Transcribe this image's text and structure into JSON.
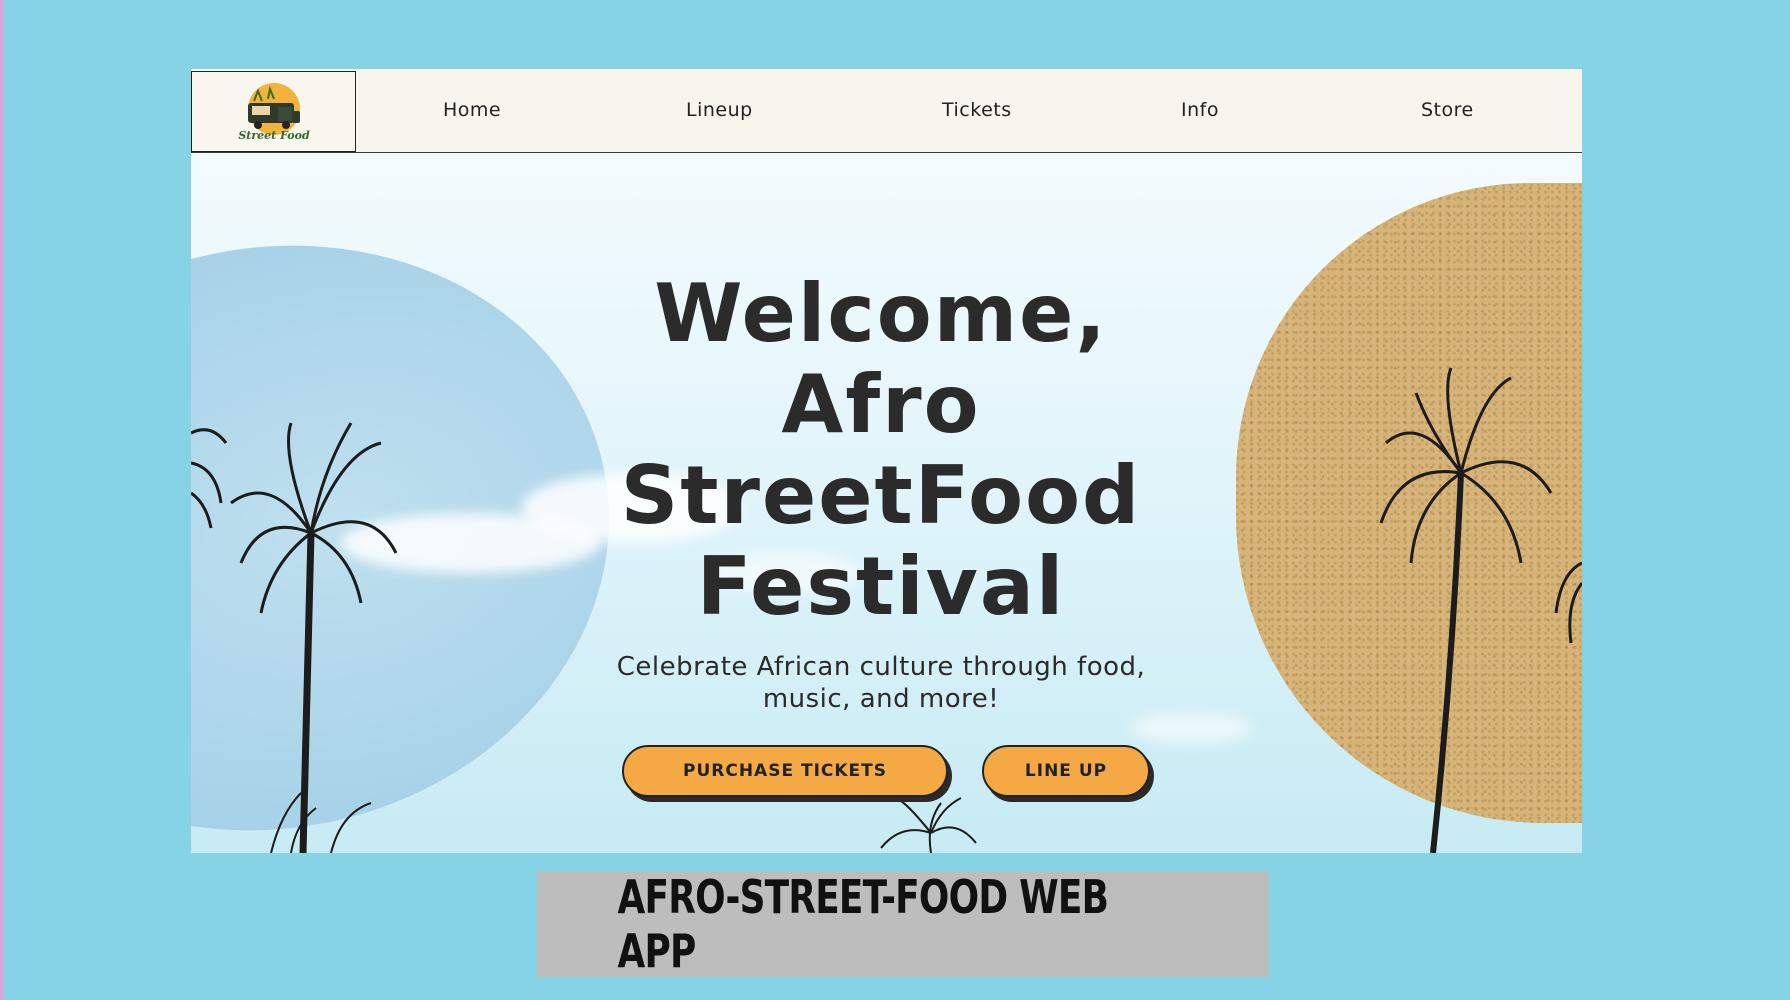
{
  "logo": {
    "text": "Street Food"
  },
  "nav": {
    "items": [
      {
        "label": "Home"
      },
      {
        "label": "Lineup"
      },
      {
        "label": "Tickets"
      },
      {
        "label": "Info"
      },
      {
        "label": "Store"
      }
    ]
  },
  "hero": {
    "title_lines": [
      "Welcome,",
      "Afro",
      "StreetFood",
      "Festival"
    ],
    "subtitle_line1": "Celebrate African culture through food,",
    "subtitle_line2": "music, and more!",
    "primary_button": "PURCHASE TICKETS",
    "secondary_button": "LINE UP"
  },
  "caption": "AFRO-STREET-FOOD WEB APP",
  "colors": {
    "background": "#86d3e6",
    "accent_button": "#f5a944",
    "sand": "#d7b57a",
    "text": "#2b2b2b"
  }
}
